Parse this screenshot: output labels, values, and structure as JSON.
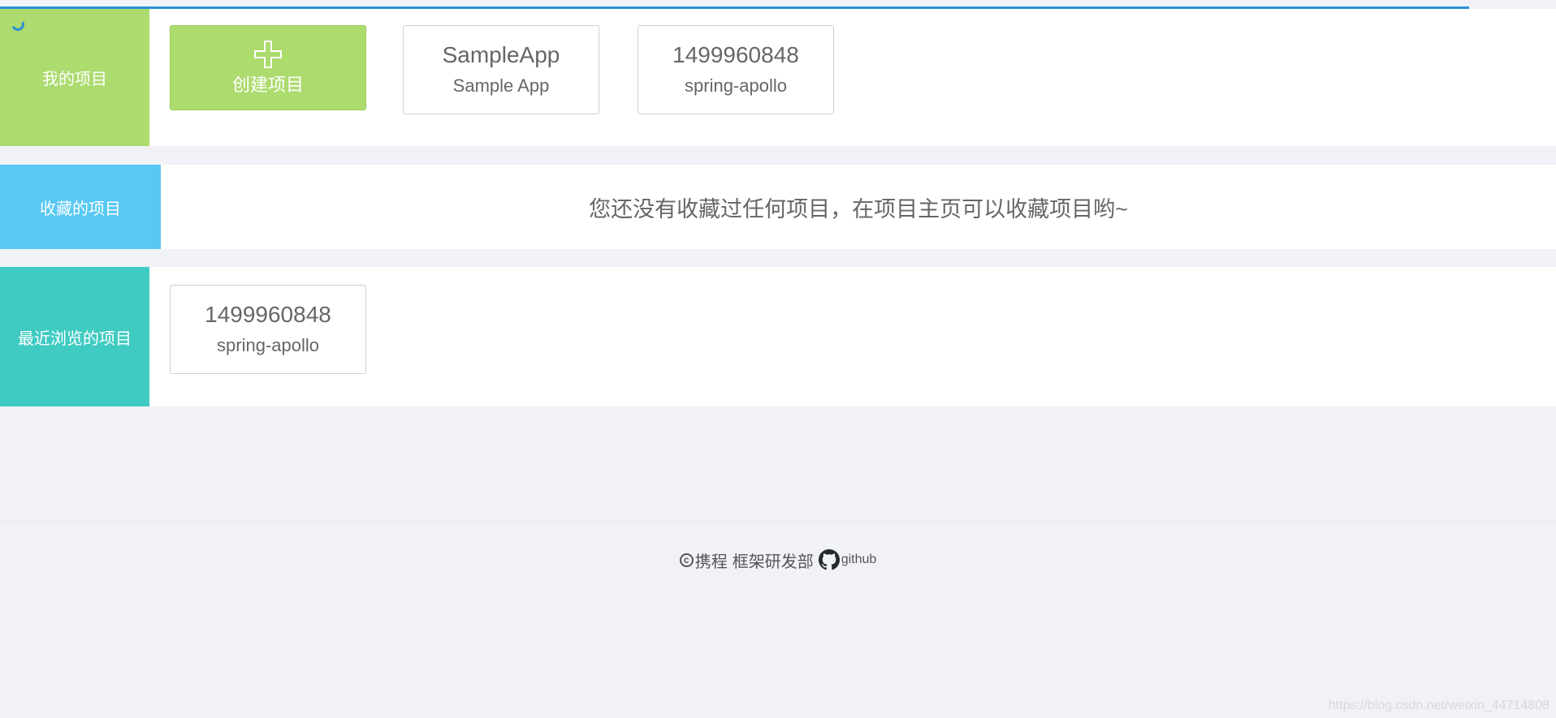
{
  "sections": {
    "mine": {
      "label": "我的项目",
      "create_card": {
        "label": "创建项目",
        "icon": "plus-icon"
      },
      "projects": [
        {
          "app_id": "SampleApp",
          "name": "Sample App"
        },
        {
          "app_id": "1499960848",
          "name": "spring-apollo"
        }
      ]
    },
    "favorites": {
      "label": "收藏的项目",
      "empty_message": "您还没有收藏过任何项目，在项目主页可以收藏项目哟~"
    },
    "recent": {
      "label": "最近浏览的项目",
      "projects": [
        {
          "app_id": "1499960848",
          "name": "spring-apollo"
        }
      ]
    }
  },
  "footer": {
    "copyright_symbol": "c",
    "company": "携程",
    "department": "框架研发部",
    "github_label": "github"
  },
  "watermark": "https://blog.csdn.net/weixin_44714808",
  "colors": {
    "mine_label_bg": "#acdb6e",
    "favorites_label_bg": "#58c8f4",
    "recent_label_bg": "#40cbc2",
    "loading_bar": "#2b8fd8"
  }
}
